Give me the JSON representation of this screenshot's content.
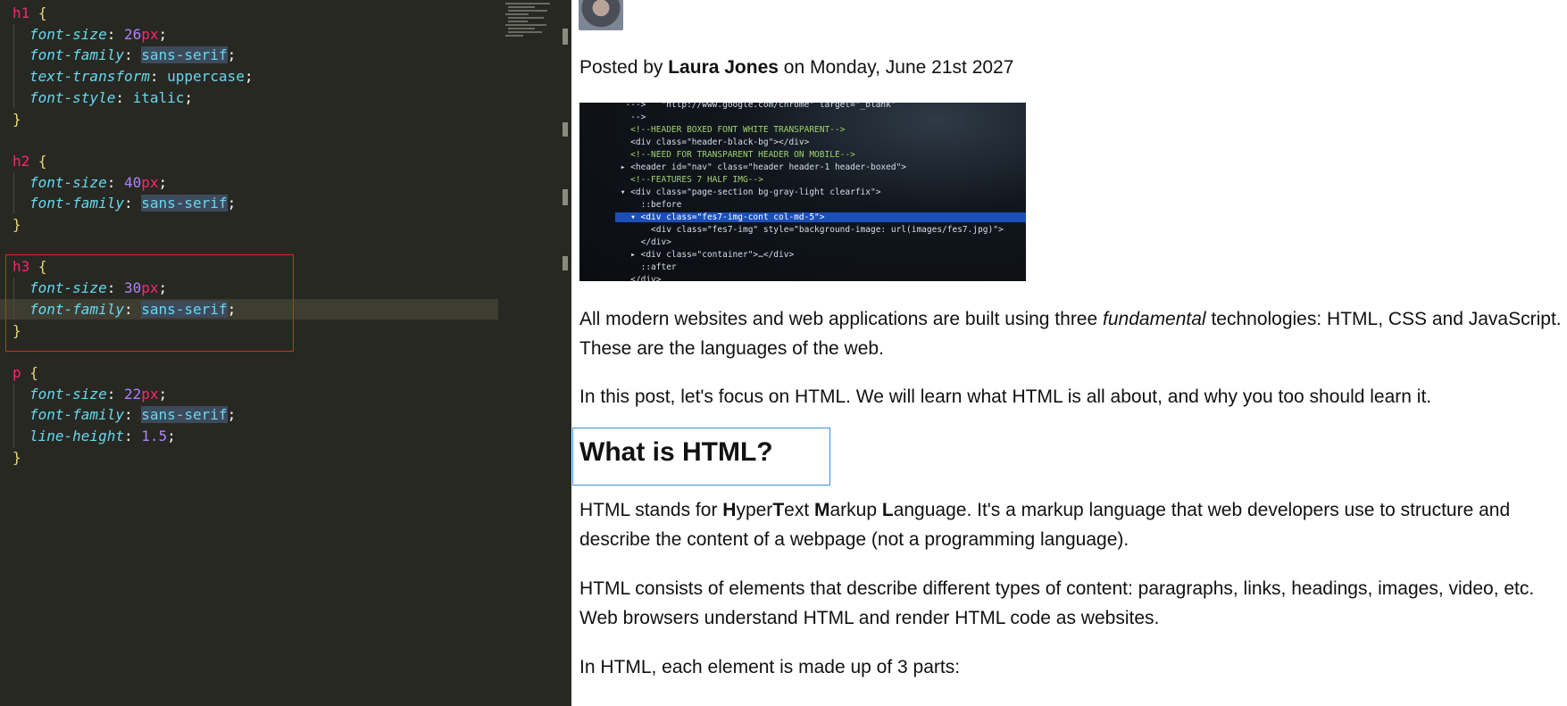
{
  "editor": {
    "rules": [
      {
        "selector": "h1",
        "declarations": [
          {
            "property": "font-size",
            "number": "26",
            "unit": "px"
          },
          {
            "property": "font-family",
            "keyword": "sans-serif",
            "keyword_highlighted": true
          },
          {
            "property": "text-transform",
            "keyword": "uppercase"
          },
          {
            "property": "font-style",
            "keyword": "italic"
          }
        ]
      },
      {
        "selector": "h2",
        "declarations": [
          {
            "property": "font-size",
            "number": "40",
            "unit": "px"
          },
          {
            "property": "font-family",
            "keyword": "sans-serif",
            "keyword_highlighted": true
          }
        ]
      },
      {
        "selector": "h3",
        "declarations": [
          {
            "property": "font-size",
            "number": "30",
            "unit": "px"
          },
          {
            "property": "font-family",
            "keyword": "sans-serif",
            "keyword_highlighted": true
          }
        ]
      },
      {
        "selector": "p",
        "declarations": [
          {
            "property": "font-size",
            "number": "22",
            "unit": "px"
          },
          {
            "property": "font-family",
            "keyword": "sans-serif",
            "keyword_highlighted": true
          },
          {
            "property": "line-height",
            "number": "1.5",
            "unit": ""
          }
        ]
      }
    ],
    "open_brace": "{",
    "close_brace": "}",
    "colon": ":",
    "semicolon": ";",
    "highlighted_rule": "h3",
    "colors": {
      "background": "#272822",
      "selector": "#f92672",
      "property": "#66d9ef",
      "number": "#ae81ff",
      "brace": "#e6db74",
      "highlight_border": "#e0261f"
    }
  },
  "preview": {
    "avatar_icon": "avatar-photo",
    "byline": {
      "prefix": "Posted by ",
      "author": "Laura Jones",
      "suffix": " on Monday, June 21st 2027"
    },
    "hero_image": {
      "description_icon": "code-screenshot-image",
      "lines": [
        "  --->   \"http://www.google.com/chrome\" target=\"_blank\"",
        "   -->",
        "   <!--HEADER BOXED FONT WHITE TRANSPARENT-->",
        "   <div class=\"header-black-bg\"></div>",
        "   <!--NEED FOR TRANSPARENT HEADER ON MOBILE-->",
        " ▸ <header id=\"nav\" class=\"header header-1 header-boxed\">",
        "   <!--FEATURES 7 HALF IMG-->",
        " ▾ <div class=\"page-section bg-gray-light clearfix\">",
        "     ::before",
        "   ▾ <div class=\"fes7-img-cont col-md-5\">",
        "       <div class=\"fes7-img\" style=\"background-image: url(images/fes7.jpg)\">",
        "     </div>",
        "   ▸ <div class=\"container\">…</div>",
        "     ::after",
        "   </div>"
      ],
      "selected_line_index": 9
    },
    "paragraphs": [
      {
        "parts": [
          {
            "text": "All modern websites and web applications are built using three ",
            "style": "normal"
          },
          {
            "text": "fundamental",
            "style": "italic"
          },
          {
            "text": " technologies: HTML, CSS and JavaScript. These are the languages of the web.",
            "style": "normal"
          }
        ]
      },
      {
        "parts": [
          {
            "text": "In this post, let's focus on HTML. We will learn what HTML is all about, and why you too should learn it.",
            "style": "normal"
          }
        ]
      }
    ],
    "heading": "What is HTML?",
    "paragraphs_after": [
      {
        "parts": [
          {
            "text": "HTML stands for ",
            "style": "normal"
          },
          {
            "text": "H",
            "style": "bold"
          },
          {
            "text": "yper",
            "style": "normal"
          },
          {
            "text": "T",
            "style": "bold"
          },
          {
            "text": "ext ",
            "style": "normal"
          },
          {
            "text": "M",
            "style": "bold"
          },
          {
            "text": "arkup ",
            "style": "normal"
          },
          {
            "text": "L",
            "style": "bold"
          },
          {
            "text": "anguage. It's a markup language that web developers use to structure and describe the content of a webpage (not a programming language).",
            "style": "normal"
          }
        ]
      },
      {
        "parts": [
          {
            "text": "HTML consists of elements that describe different types of content: paragraphs, links, headings, images, video, etc. Web browsers understand HTML and render HTML code as websites.",
            "style": "normal"
          }
        ]
      },
      {
        "parts": [
          {
            "text": "In HTML, each element is made up of 3 parts:",
            "style": "normal"
          }
        ]
      }
    ],
    "heading_focus_color": "#3c8ee8"
  }
}
